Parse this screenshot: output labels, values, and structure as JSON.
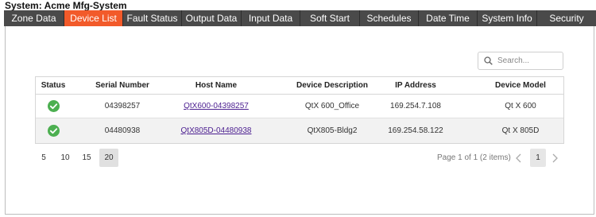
{
  "system": {
    "title": "System: Acme Mfg-System"
  },
  "tabs": [
    {
      "label": "Zone Data"
    },
    {
      "label": "Device List",
      "active": true
    },
    {
      "label": "Fault Status"
    },
    {
      "label": "Output Data"
    },
    {
      "label": "Input Data"
    },
    {
      "label": "Soft Start"
    },
    {
      "label": "Schedules"
    },
    {
      "label": "Date Time"
    },
    {
      "label": "System Info"
    },
    {
      "label": "Security"
    }
  ],
  "search": {
    "placeholder": "Search...",
    "icon": "search-icon"
  },
  "table": {
    "headers": [
      "Status",
      "Serial Number",
      "Host Name",
      "Device Description",
      "IP Address",
      "Device Model"
    ],
    "rows": [
      {
        "status": "ok",
        "serial": "04398257",
        "host": "QtX600-04398257",
        "description": "QtX 600_Office",
        "ip": "169.254.7.108",
        "model": "Qt X 600"
      },
      {
        "status": "ok",
        "serial": "04480938",
        "host": "QtX805D-04480938",
        "description": "QtX805-Bldg2",
        "ip": "169.254.58.122",
        "model": "Qt X 805D"
      }
    ]
  },
  "pager": {
    "sizes": [
      "5",
      "10",
      "15",
      "20"
    ],
    "selected_size": "20",
    "info": "Page 1 of 1 (2 items)",
    "current_page": "1"
  },
  "colors": {
    "accent": "#f25a2a",
    "tabbar": "#4a4a4a",
    "status_ok": "#4caf50",
    "link": "#4a1d8f"
  }
}
